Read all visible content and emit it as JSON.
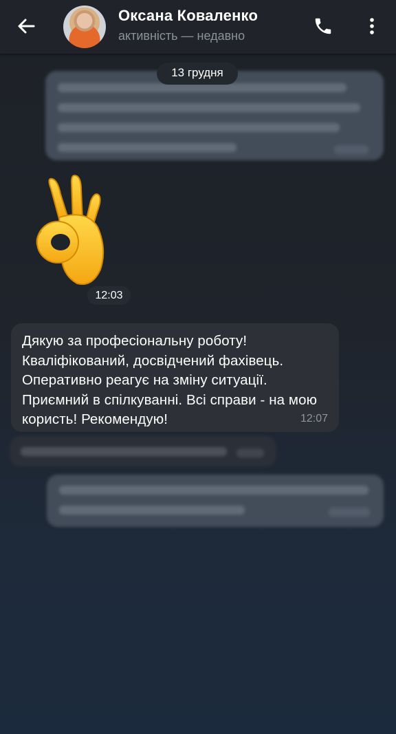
{
  "header": {
    "title": "Оксана Коваленко",
    "subtitle": "активність — недавно",
    "icons": {
      "back": "arrow-left-icon",
      "call": "phone-icon",
      "more": "more-vertical-icon"
    }
  },
  "chat": {
    "date_label": "13 грудня",
    "sticker": {
      "emoji": "ok-hand",
      "time": "12:03"
    },
    "message": {
      "text": "Дякую за професіональну роботу! Кваліфікований, досвідчений фахівець. Оперативно реагує на зміну ситуації. Приємний в спілкуванні. Всі справи - на мою користь! Рекомендую!",
      "time": "12:07"
    }
  },
  "colors": {
    "header_bg": "#202329",
    "incoming_bubble": "#2d3036",
    "outgoing_bubble": "#434d5a",
    "emoji_yellow": "#f7c12c"
  }
}
